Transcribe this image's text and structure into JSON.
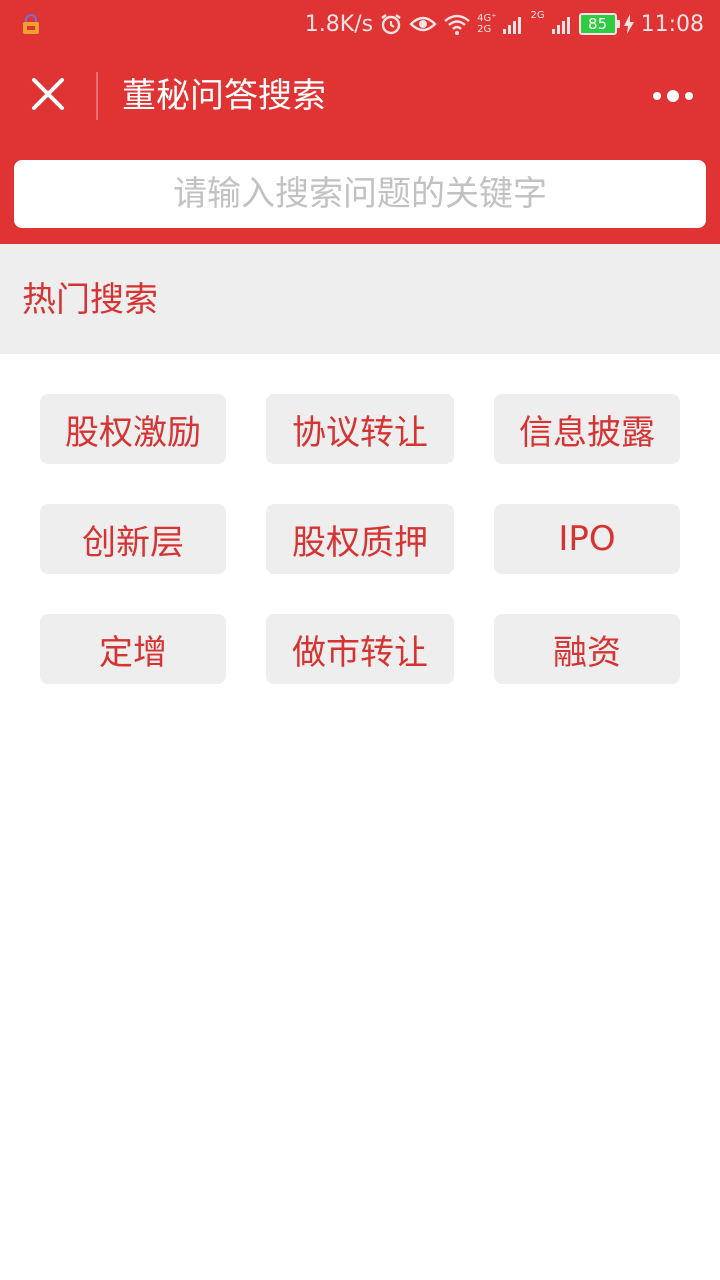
{
  "status_bar": {
    "net_speed": "1.8K/s",
    "net_4g": "4G⁺",
    "net_2g_a": "2G",
    "net_2g_b": "2G",
    "battery": "85",
    "time": "11:08"
  },
  "header": {
    "title": "董秘问答搜索"
  },
  "search": {
    "placeholder": "请输入搜索问题的关键字"
  },
  "hot_search": {
    "title": "热门搜索",
    "tags": [
      "股权激励",
      "协议转让",
      "信息披露",
      "创新层",
      "股权质押",
      "IPO",
      "定增",
      "做市转让",
      "融资"
    ]
  },
  "colors": {
    "brand_red": "#e03333",
    "tag_text": "#d63333",
    "tag_bg": "#eeeeee"
  }
}
